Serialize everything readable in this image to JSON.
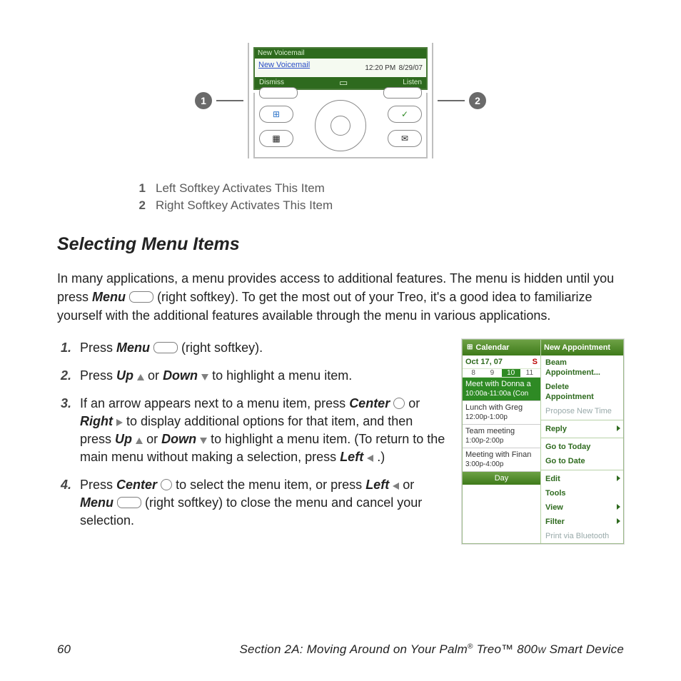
{
  "device_fig": {
    "callout1": "1",
    "callout2": "2",
    "screen": {
      "titlebar": "New Voicemail",
      "link": "New Voicemail",
      "time": "12:20 PM",
      "date": "8/29/07",
      "soft_left": "Dismiss",
      "soft_right": "Listen"
    }
  },
  "legend": [
    {
      "num": "1",
      "text": "Left Softkey Activates This Item"
    },
    {
      "num": "2",
      "text": "Right Softkey Activates This Item"
    }
  ],
  "heading": "Selecting Menu Items",
  "intro": {
    "p1a": "In many applications, a menu provides access to additional features. The menu is hidden until you press ",
    "menu": "Menu",
    "p1b": " (right softkey). To get the most out of your Treo, it's a good idea to familiarize yourself with the additional features available through the menu in various applications."
  },
  "steps": {
    "s1": {
      "a": "Press ",
      "menu": "Menu",
      "b": " (right softkey)."
    },
    "s2": {
      "a": "Press ",
      "up": "Up",
      "b": " or ",
      "down": "Down",
      "c": " to highlight a menu item."
    },
    "s3": {
      "a": "If an arrow appears next to a menu item, press ",
      "center": "Center",
      "b": " or ",
      "right": "Right",
      "c": " to display additional options for that item, and then press ",
      "up": "Up",
      "d": " or ",
      "down": "Down",
      "e": " to highlight a menu item. (To return to the main menu without making a selection, press ",
      "left": "Left",
      "f": ".)"
    },
    "s4": {
      "a": "Press ",
      "center": "Center",
      "b": " to select the menu item, or press ",
      "left": "Left",
      "c": " or ",
      "menu": "Menu",
      "d": " (right softkey) to close the menu and cancel your selection."
    }
  },
  "calendar": {
    "title": "Calendar",
    "menu_header": "New Appointment",
    "date": "Oct 17, 07",
    "s_label": "S",
    "weekdays": [
      "8",
      "9",
      "10",
      "11"
    ],
    "events": [
      {
        "name": "Meet with Donna a",
        "time": "10:00a-11:00a (Con",
        "selected": true
      },
      {
        "name": "Lunch with Greg",
        "time": "12:00p-1:00p"
      },
      {
        "name": "Team meeting",
        "time": "1:00p-2:00p"
      },
      {
        "name": "Meeting with Finan",
        "time": "3:00p-4:00p"
      }
    ],
    "softbar": "Day",
    "menu": [
      {
        "label": "Beam Appointment..."
      },
      {
        "label": "Delete Appointment"
      },
      {
        "label": "Propose New Time",
        "disabled": true,
        "sepAfter": true
      },
      {
        "label": "Reply",
        "arrow": true,
        "sepAfter": true
      },
      {
        "label": "Go to Today"
      },
      {
        "label": "Go to Date",
        "sepAfter": true
      },
      {
        "label": "Edit",
        "arrow": true
      },
      {
        "label": "Tools"
      },
      {
        "label": "View",
        "arrow": true
      },
      {
        "label": "Filter",
        "arrow": true
      },
      {
        "label": "Print via Bluetooth",
        "disabled": true
      }
    ]
  },
  "footer": {
    "page": "60",
    "title_a": "Section 2A: Moving Around on Your Palm",
    "reg": "®",
    "treo": " Treo™ 800",
    "w": "W",
    "tail": " Smart Device"
  }
}
